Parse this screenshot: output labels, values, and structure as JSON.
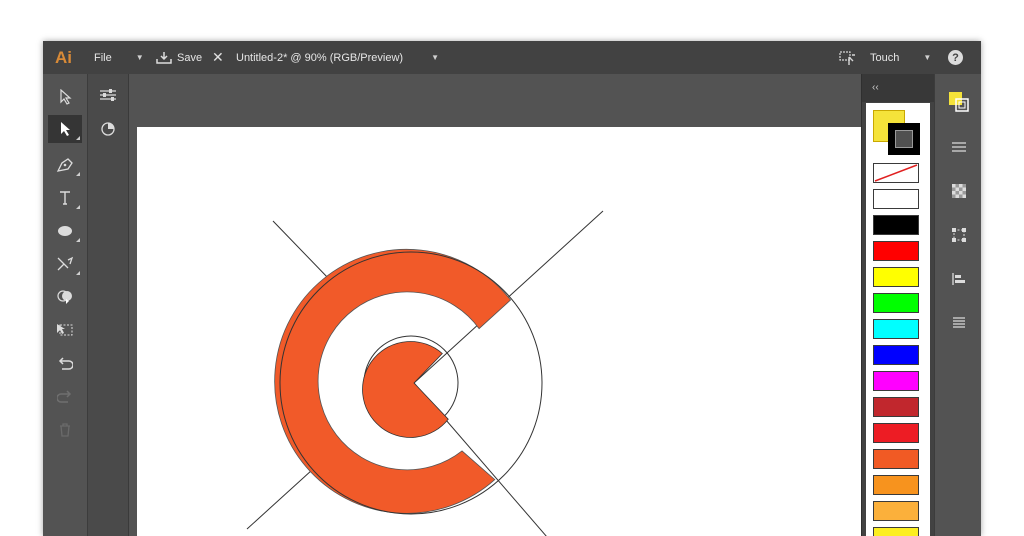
{
  "app": {
    "logo": "Ai",
    "menu_file": "File",
    "save_label": "Save",
    "document_title": "Untitled-2* @ 90% (RGB/Preview)",
    "workspace": "Touch",
    "help": "?"
  },
  "toolbar": {
    "tools": [
      "selection-tool",
      "direct-selection-tool",
      "pen-tool",
      "type-tool",
      "ellipse-tool",
      "scissors-tool",
      "shape-builder-tool",
      "free-transform-tool",
      "undo",
      "redo",
      "delete"
    ],
    "active_tool": "direct-selection-tool"
  },
  "panels": {
    "collapse_label": "‹‹",
    "fill_color": "#f5e33a",
    "stroke_color": "#000000",
    "swatches": [
      {
        "name": "none",
        "color": "#ffffff"
      },
      {
        "name": "white",
        "color": "#ffffff"
      },
      {
        "name": "black",
        "color": "#000000"
      },
      {
        "name": "red",
        "color": "#ff0000"
      },
      {
        "name": "yellow",
        "color": "#ffff00"
      },
      {
        "name": "green",
        "color": "#00ff00"
      },
      {
        "name": "cyan",
        "color": "#00ffff"
      },
      {
        "name": "blue",
        "color": "#0000ff"
      },
      {
        "name": "magenta",
        "color": "#ff00ff"
      },
      {
        "name": "dark-red",
        "color": "#c1272d"
      },
      {
        "name": "red-2",
        "color": "#ed1c24"
      },
      {
        "name": "orange-red",
        "color": "#f15a24"
      },
      {
        "name": "orange",
        "color": "#f7931e"
      },
      {
        "name": "light-orange",
        "color": "#fbb03b"
      },
      {
        "name": "yellow-2",
        "color": "#fcee21"
      }
    ]
  },
  "artwork": {
    "accent_color": "#f15a29",
    "stroke_color": "#333333"
  }
}
